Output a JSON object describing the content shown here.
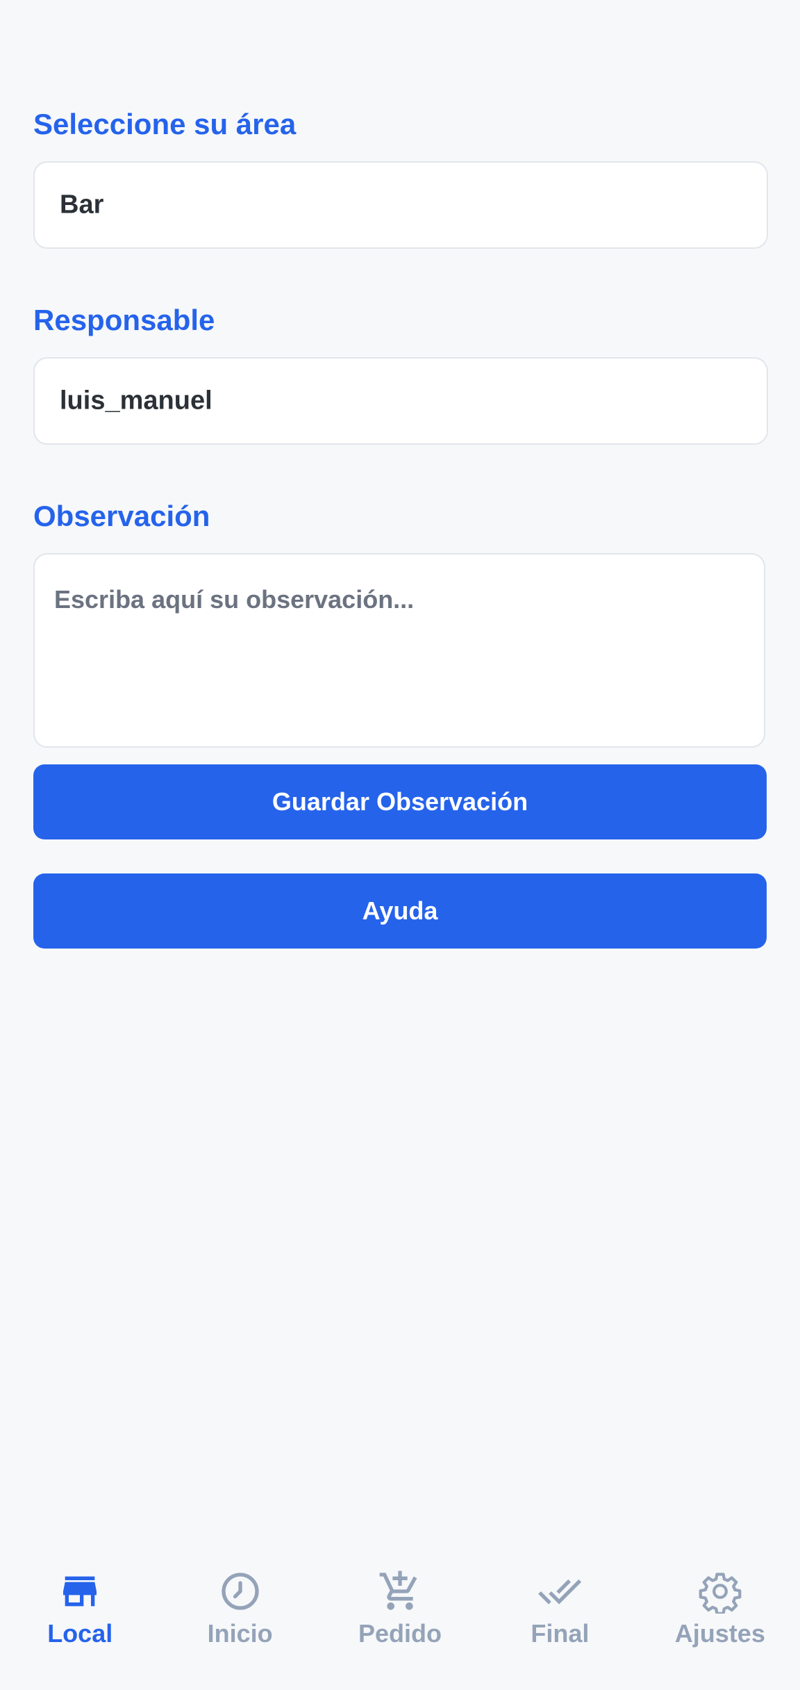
{
  "colors": {
    "accent": "#2563eb",
    "inactive": "#94a3b8",
    "background": "#f7f8fa",
    "text": "#2b3136"
  },
  "form": {
    "area": {
      "label": "Seleccione su área",
      "value": "Bar"
    },
    "responsable": {
      "label": "Responsable",
      "value": "luis_manuel"
    },
    "observacion": {
      "label": "Observación",
      "placeholder": "Escriba aquí su observación...",
      "value": ""
    }
  },
  "buttons": {
    "save": "Guardar Observación",
    "help": "Ayuda"
  },
  "nav": {
    "items": [
      {
        "label": "Local",
        "icon": "store-icon",
        "active": true
      },
      {
        "label": "Inicio",
        "icon": "clock-icon",
        "active": false
      },
      {
        "label": "Pedido",
        "icon": "cart-add-icon",
        "active": false
      },
      {
        "label": "Final",
        "icon": "double-check-icon",
        "active": false
      },
      {
        "label": "Ajustes",
        "icon": "gear-icon",
        "active": false
      }
    ]
  }
}
